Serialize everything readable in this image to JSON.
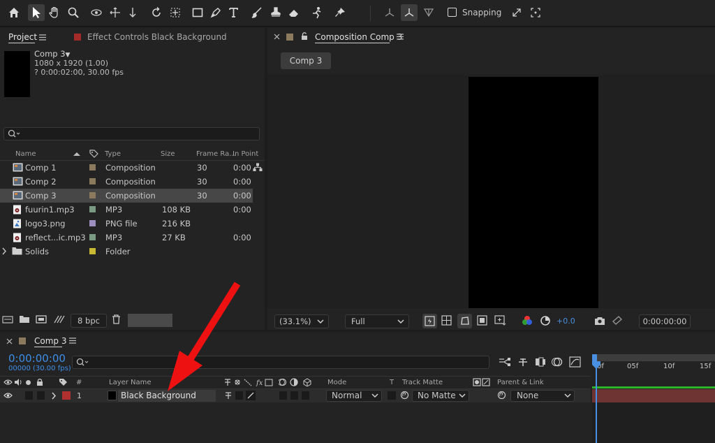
{
  "project": {
    "tab_label": "Project",
    "effect_controls_label": "Effect Controls Black Background",
    "comp_name": "Comp 3",
    "comp_dims": "1080 x 1920 (1.00)",
    "comp_duration": "? 0:00:02:00, 30.00 fps",
    "search_placeholder": "",
    "columns": [
      "Name",
      "Type",
      "Size",
      "Frame Ra...",
      "In Point"
    ],
    "items": [
      {
        "name": "Comp 1",
        "type": "Composition",
        "size": "",
        "fps": "30",
        "in": "0:00:",
        "label_color": "#8b7b5c",
        "icon": "composition-icon"
      },
      {
        "name": "Comp 2",
        "type": "Composition",
        "size": "",
        "fps": "30",
        "in": "0:00:",
        "label_color": "#8b7b5c",
        "icon": "composition-icon"
      },
      {
        "name": "Comp 3",
        "type": "Composition",
        "size": "",
        "fps": "30",
        "in": "0:00:",
        "label_color": "#8b7b5c",
        "icon": "composition-icon"
      },
      {
        "name": "fuurin1.mp3",
        "type": "MP3",
        "size": "108 KB",
        "fps": "",
        "in": "0:00:",
        "label_color": "#7a9a84",
        "icon": "audio-file-icon"
      },
      {
        "name": "logo3.png",
        "type": "PNG file",
        "size": "216 KB",
        "fps": "",
        "in": "",
        "label_color": "#9d8ec0",
        "icon": "image-file-icon"
      },
      {
        "name": "reflect...ic.mp3",
        "type": "MP3",
        "size": "27 KB",
        "fps": "",
        "in": "0:00:",
        "label_color": "#7a9a84",
        "icon": "audio-file-icon"
      },
      {
        "name": "Solids",
        "type": "Folder",
        "size": "",
        "fps": "",
        "in": "",
        "label_color": "#c8b832",
        "icon": "folder-icon"
      }
    ],
    "bpc_label": "8 bpc"
  },
  "viewer": {
    "tab_label": "Composition Comp 3",
    "comp_button": "Comp 3",
    "zoom": "(33.1%)",
    "resolution": "Full",
    "exposure": "+0.0",
    "timecode": "0:00:00:00"
  },
  "toolbar": {
    "snapping_label": "Snapping"
  },
  "timeline": {
    "tab_label": "Comp 3",
    "timecode": "0:00:00:00",
    "frames": "00000 (30.00 fps)",
    "ruler": [
      "0f",
      "05f",
      "10f",
      "15f"
    ],
    "columns": {
      "number": "#",
      "layer_name": "Layer Name",
      "mode": "Mode",
      "t": "T",
      "track_matte": "Track Matte",
      "parent": "Parent & Link"
    },
    "layer": {
      "number": "1",
      "name": "Black Background",
      "mode": "Normal",
      "track_matte": "No Matte",
      "parent": "None",
      "label_color": "#b03030"
    }
  },
  "colors": {
    "accent_blue": "#4a90e2",
    "timecode_blue": "#3d8ee8",
    "annotation_red": "#ee1111",
    "layer_bar": "#6e3434"
  }
}
